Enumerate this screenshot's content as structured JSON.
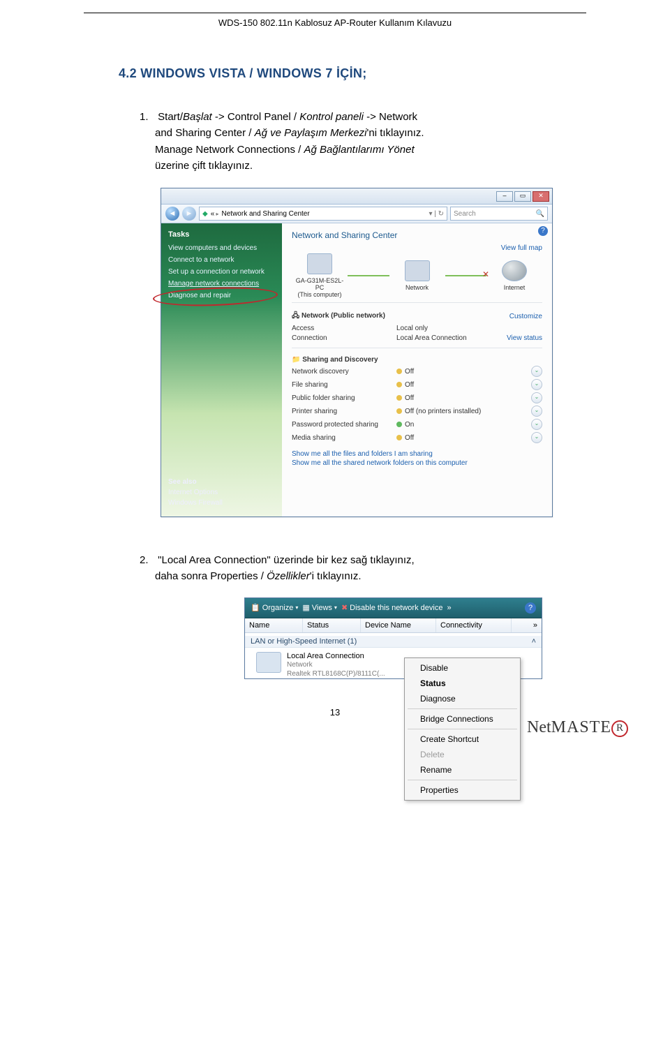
{
  "header": {
    "title": "WDS-150 802.11n Kablosuz AP-Router Kullanım Kılavuzu"
  },
  "section": {
    "heading": "4.2 WINDOWS VISTA / WINDOWS 7 İÇİN;"
  },
  "step1": {
    "num": "1.",
    "l1a": "Start/",
    "l1b": "Başlat",
    "l1c": " -> Control Panel / ",
    "l1d": "Kontrol paneli",
    "l1e": " -> Network",
    "l2a": "and Sharing Center / ",
    "l2b": "Ağ ve Paylaşım Merkezi",
    "l2c": "'ni tıklayınız.",
    "l3a": "Manage Network Connections / ",
    "l3b": "Ağ Bağlantılarımı Yönet",
    "l4": "üzerine çift tıklayınız."
  },
  "win1": {
    "crumb": "Network and Sharing Center",
    "search": "Search",
    "tasks_hdr": "Tasks",
    "task_view": "View computers and devices",
    "task_connect": "Connect to a network",
    "task_setup": "Set up a connection or network",
    "task_manage": "Manage network connections",
    "task_diag": "Diagnose and repair",
    "seealso": "See also",
    "sa1": "Internet Options",
    "sa2": "Windows Firewall",
    "main_title": "Network and Sharing Center",
    "viewmap": "View full map",
    "node_pc1": "GA-G31M-ES2L-PC",
    "node_pc2": "(This computer)",
    "node_net": "Network",
    "node_inet": "Internet",
    "net_hdr": "Network (Public network)",
    "customize": "Customize",
    "access_k": "Access",
    "access_v": "Local only",
    "conn_k": "Connection",
    "conn_v": "Local Area Connection",
    "viewstatus": "View status",
    "sd_hdr": "Sharing and Discovery",
    "sd": [
      {
        "k": "Network discovery",
        "v": "Off",
        "dot": "off"
      },
      {
        "k": "File sharing",
        "v": "Off",
        "dot": "off"
      },
      {
        "k": "Public folder sharing",
        "v": "Off",
        "dot": "off"
      },
      {
        "k": "Printer sharing",
        "v": "Off (no printers installed)",
        "dot": "off"
      },
      {
        "k": "Password protected sharing",
        "v": "On",
        "dot": "on"
      },
      {
        "k": "Media sharing",
        "v": "Off",
        "dot": "off"
      }
    ],
    "show1": "Show me all the files and folders I am sharing",
    "show2": "Show me all the shared network folders on this computer"
  },
  "step2": {
    "num": "2.",
    "l1": "\"Local Area Connection\" üzerinde bir kez sağ tıklayınız,",
    "l2a": "daha sonra Properties / ",
    "l2b": "Özellikler",
    "l2c": "'i tıklayınız."
  },
  "win2": {
    "organize": "Organize",
    "views": "Views",
    "disable": "Disable this network device",
    "more": "»",
    "cols": {
      "name": "Name",
      "status": "Status",
      "dev": "Device Name",
      "conn": "Connectivity",
      "more": "»"
    },
    "group": "LAN or High-Speed Internet (1)",
    "item_title": "Local Area Connection",
    "item_sub1": "Network",
    "item_sub2": "Realtek RTL8168C(P)/8111C(...",
    "menu": {
      "disable": "Disable",
      "status": "Status",
      "diagnose": "Diagnose",
      "bridge": "Bridge Connections",
      "shortcut": "Create Shortcut",
      "delete": "Delete",
      "rename": "Rename",
      "properties": "Properties"
    }
  },
  "page_number": "13",
  "brand": {
    "a": "Net",
    "b": "MASTE",
    "c": "R"
  }
}
